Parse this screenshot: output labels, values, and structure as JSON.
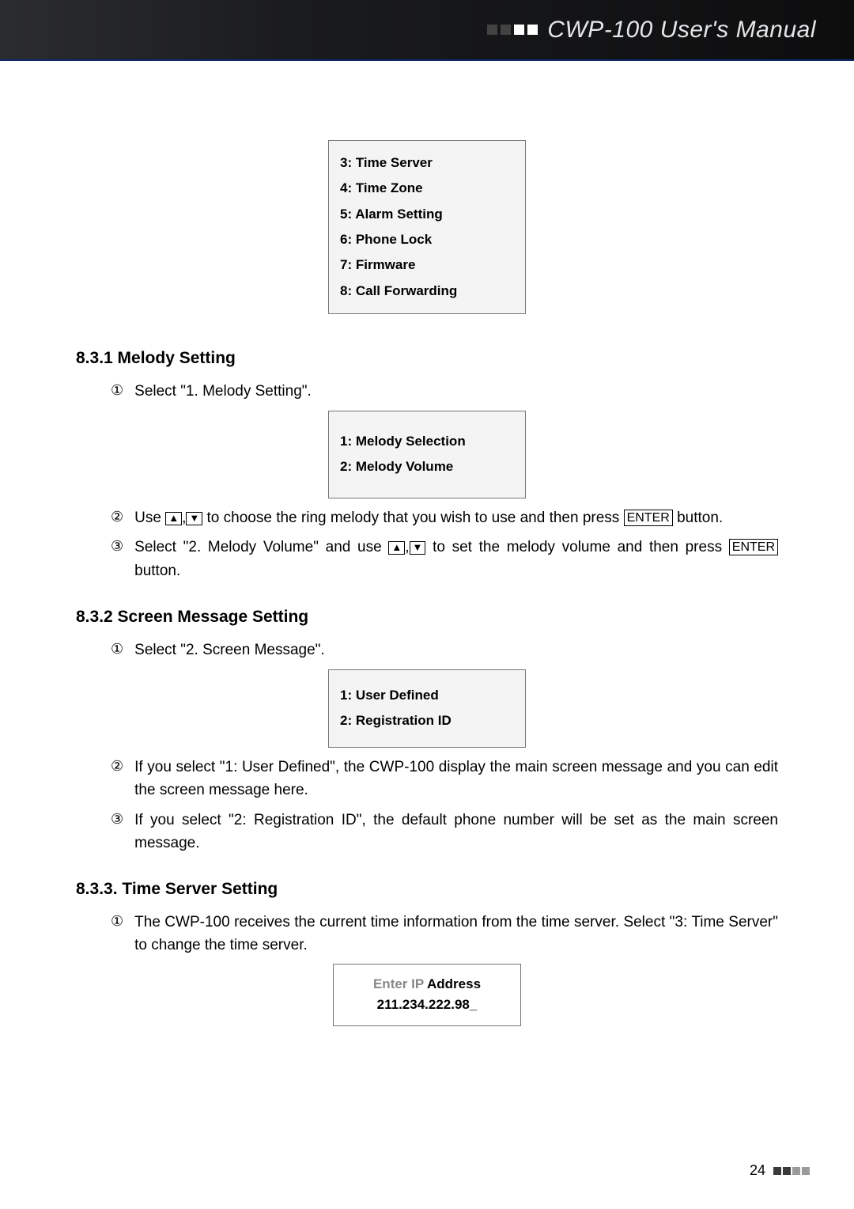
{
  "banner": {
    "title": "CWP-100 User's Manual"
  },
  "topMenu": {
    "items": [
      "3: Time Server",
      "4: Time Zone",
      "5: Alarm Setting",
      "6: Phone Lock",
      "7: Firmware",
      "8: Call Forwarding"
    ]
  },
  "sec831": {
    "heading": "8.3.1 Melody Setting",
    "step1_num": "①",
    "step1_txt": "Select \"1. Melody Setting\".",
    "box": {
      "i1": "1: Melody Selection",
      "i2": "2: Melody Volume"
    },
    "step2_num": "②",
    "step2_pre": "Use ",
    "step2_mid": " to choose the ring melody that you wish to use and then press ",
    "step2_post": " button.",
    "step3_num": "③",
    "step3_pre": "Select \"2. Melody Volume\" and use ",
    "step3_mid": " to set the melody volume and then press ",
    "step3_post": " button.",
    "key_up": "▲",
    "key_comma": ",",
    "key_down": "▼",
    "key_enter": "ENTER"
  },
  "sec832": {
    "heading": "8.3.2 Screen Message Setting",
    "step1_num": "①",
    "step1_txt": "Select \"2. Screen Message\".",
    "box": {
      "i1": "1: User Defined",
      "i2": "2: Registration ID"
    },
    "step2_num": "②",
    "step2_txt": "If you select \"1: User Defined\", the CWP-100 display the main screen message and you can edit the screen message here.",
    "step3_num": "③",
    "step3_txt": "If you select \"2: Registration ID\", the default phone number will be set as the main screen message."
  },
  "sec833": {
    "heading": "8.3.3. Time Server Setting",
    "step1_num": "①",
    "step1_txt": "The CWP-100 receives the current time information from the time server. Select \"3: Time Server\" to change the time server.",
    "box": {
      "l1a": "Enter IP ",
      "l1b": "Address",
      "l2": "211.234.222.98_"
    }
  },
  "footer": {
    "page": "24"
  }
}
